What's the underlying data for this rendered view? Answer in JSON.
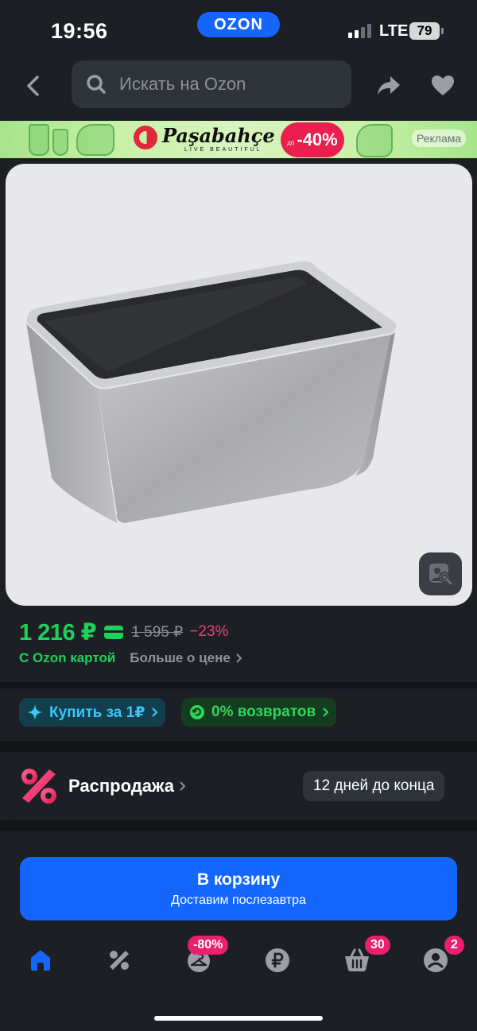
{
  "status_bar": {
    "time": "19:56",
    "brand": "OZON",
    "network": "LTE",
    "battery": "79"
  },
  "header": {
    "search_placeholder": "Искать на Ozon",
    "icons": [
      "back-arrow-icon",
      "search-icon",
      "share-icon",
      "heart-icon"
    ]
  },
  "ad_banner": {
    "brand": "Paşabahçe",
    "tagline": "LIVE BEAUTIFUL",
    "discount_prefix": "до",
    "discount": "-40%",
    "label": "Реклама"
  },
  "product": {
    "image_alt": "loaf-pan",
    "visual_search_icon": "image-search-icon"
  },
  "price": {
    "current": "1 216 ₽",
    "old": "1 595 ₽",
    "discount": "−23%",
    "ozon_card_label": "С Ozon картой",
    "more_label": "Больше о цене"
  },
  "offers": {
    "buy_label": "Купить за 1₽",
    "return_label": "0% возвратов"
  },
  "sale": {
    "title": "Распродажа",
    "badge": "12 дней до конца"
  },
  "cart": {
    "label": "В корзину",
    "sub": "Доставим послезавтра"
  },
  "tabs": {
    "promo_badge": "-80%",
    "cart_badge": "30",
    "profile_badge": "2"
  },
  "colors": {
    "accent": "#1466ff",
    "price_green": "#1fd15a",
    "discount_pink": "#f0407a",
    "badge_pink": "#ea1f6f"
  }
}
